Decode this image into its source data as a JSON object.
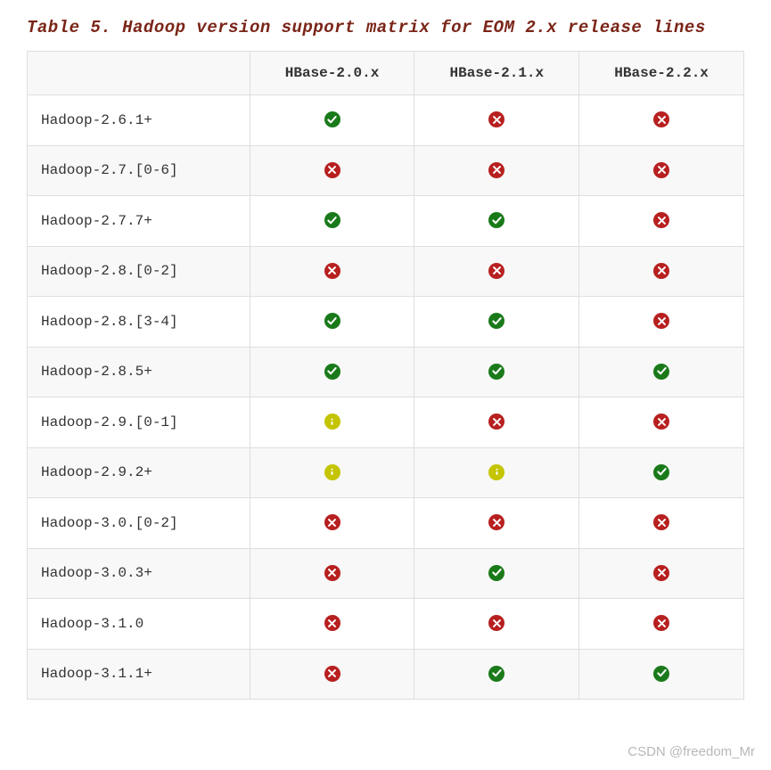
{
  "caption": "Table 5. Hadoop version support matrix for EOM 2.x release lines",
  "columns": [
    "",
    "HBase-2.0.x",
    "HBase-2.1.x",
    "HBase-2.2.x"
  ],
  "rows": [
    {
      "label": "Hadoop-2.6.1+",
      "cells": [
        "check",
        "x",
        "x"
      ]
    },
    {
      "label": "Hadoop-2.7.[0-6]",
      "cells": [
        "x",
        "x",
        "x"
      ]
    },
    {
      "label": "Hadoop-2.7.7+",
      "cells": [
        "check",
        "check",
        "x"
      ]
    },
    {
      "label": "Hadoop-2.8.[0-2]",
      "cells": [
        "x",
        "x",
        "x"
      ]
    },
    {
      "label": "Hadoop-2.8.[3-4]",
      "cells": [
        "check",
        "check",
        "x"
      ]
    },
    {
      "label": "Hadoop-2.8.5+",
      "cells": [
        "check",
        "check",
        "check"
      ]
    },
    {
      "label": "Hadoop-2.9.[0-1]",
      "cells": [
        "warn",
        "x",
        "x"
      ]
    },
    {
      "label": "Hadoop-2.9.2+",
      "cells": [
        "warn",
        "warn",
        "check"
      ]
    },
    {
      "label": "Hadoop-3.0.[0-2]",
      "cells": [
        "x",
        "x",
        "x"
      ]
    },
    {
      "label": "Hadoop-3.0.3+",
      "cells": [
        "x",
        "check",
        "x"
      ]
    },
    {
      "label": "Hadoop-3.1.0",
      "cells": [
        "x",
        "x",
        "x"
      ]
    },
    {
      "label": "Hadoop-3.1.1+",
      "cells": [
        "x",
        "check",
        "check"
      ]
    }
  ],
  "icons": {
    "check": {
      "name": "check-icon",
      "label": "supported"
    },
    "x": {
      "name": "x-icon",
      "label": "not-supported"
    },
    "warn": {
      "name": "warn-icon",
      "label": "warning"
    }
  },
  "watermark": "CSDN @freedom_Mr"
}
